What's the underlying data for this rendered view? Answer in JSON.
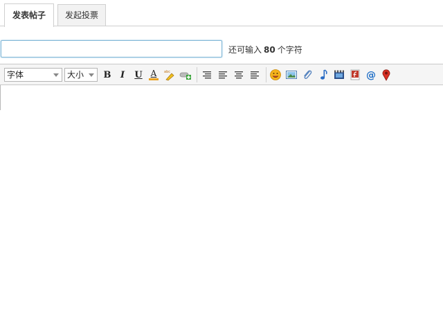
{
  "tabs": [
    {
      "label": "发表帖子",
      "active": true
    },
    {
      "label": "发起投票",
      "active": false
    }
  ],
  "subject": {
    "value": "",
    "placeholder": "",
    "remain_prefix": "还可输入",
    "remain_count": "80",
    "remain_suffix": "个字符"
  },
  "toolbar": {
    "font_select": "字体",
    "size_select": "大小",
    "bold": "B",
    "italic": "I",
    "underline": "U",
    "font_color": "A"
  },
  "colors": {
    "input_border": "#7fb6d6",
    "toolbar_bg": "#f5f5f5",
    "tab_inactive_bg": "#f2f2f2"
  },
  "icons": [
    "font-color-icon",
    "highlight-icon",
    "link-icon",
    "align-left-icon",
    "align-justify-icon",
    "align-center-icon",
    "align-right-icon",
    "emoticon-icon",
    "image-icon",
    "attachment-icon",
    "music-icon",
    "video-icon",
    "flash-icon",
    "at-icon",
    "map-marker-icon"
  ]
}
